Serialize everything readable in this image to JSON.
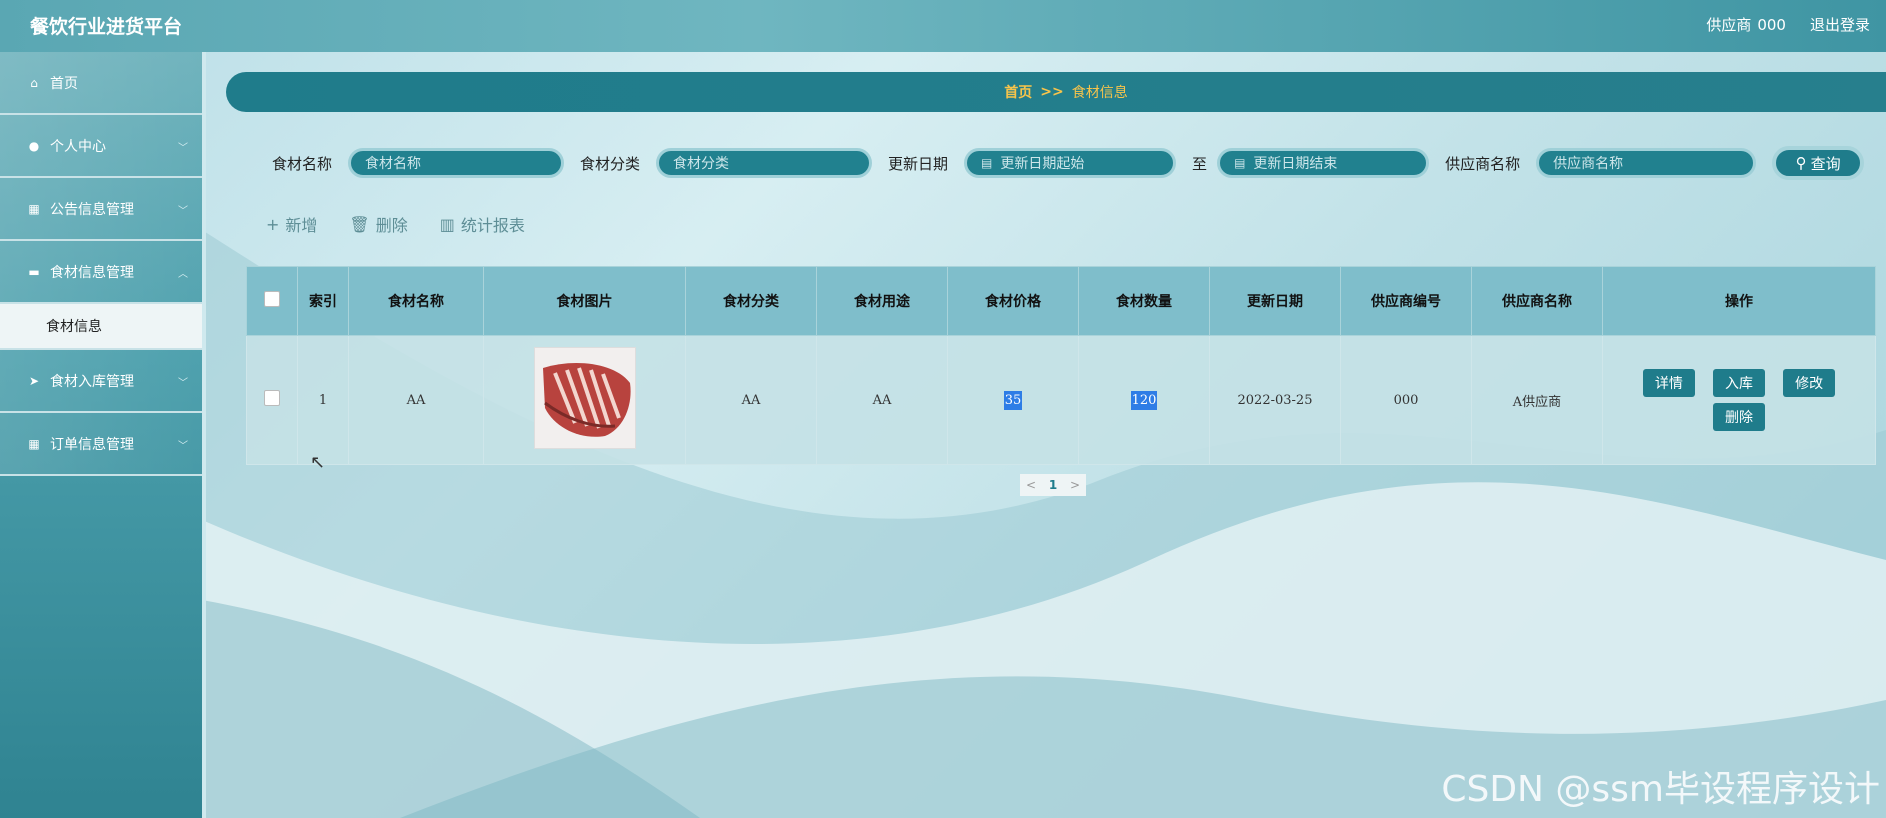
{
  "header": {
    "title": "餐饮行业进货平台",
    "user_role": "供应商",
    "user_id": "000",
    "logout": "退出登录"
  },
  "sidebar": {
    "items": [
      {
        "label": "首页",
        "icon": "home-icon"
      },
      {
        "label": "个人中心",
        "icon": "user-icon"
      },
      {
        "label": "公告信息管理",
        "icon": "grid-icon"
      },
      {
        "label": "食材信息管理",
        "icon": "box-icon"
      },
      {
        "label": "食材入库管理",
        "icon": "send-icon"
      },
      {
        "label": "订单信息管理",
        "icon": "apps-icon"
      }
    ],
    "sub_item": "食材信息"
  },
  "breadcrumb": {
    "home": "首页",
    "sep": ">>",
    "current": "食材信息"
  },
  "search": {
    "name_label": "食材名称",
    "name_placeholder": "食材名称",
    "category_label": "食材分类",
    "category_placeholder": "食材分类",
    "date_label": "更新日期",
    "date_start_placeholder": "更新日期起始",
    "to": "至",
    "date_end_placeholder": "更新日期结束",
    "supplier_label": "供应商名称",
    "supplier_placeholder": "供应商名称",
    "query_button": "查询"
  },
  "actions": {
    "add": "新增",
    "delete": "删除",
    "report": "统计报表"
  },
  "table": {
    "headers": [
      "索引",
      "食材名称",
      "食材图片",
      "食材分类",
      "食材用途",
      "食材价格",
      "食材数量",
      "更新日期",
      "供应商编号",
      "供应商名称",
      "操作"
    ],
    "rows": [
      {
        "index": "1",
        "name": "AA",
        "category": "AA",
        "usage": "AA",
        "price": "35",
        "quantity": "120",
        "date": "2022-03-25",
        "supplier_no": "000",
        "supplier_name": "A供应商"
      }
    ],
    "ops": {
      "detail": "详情",
      "stock_in": "入库",
      "edit": "修改",
      "remove": "删除"
    }
  },
  "pager": {
    "prev": "<",
    "page": "1",
    "next": ">"
  },
  "watermark": "CSDN @ssm毕设程序设计"
}
